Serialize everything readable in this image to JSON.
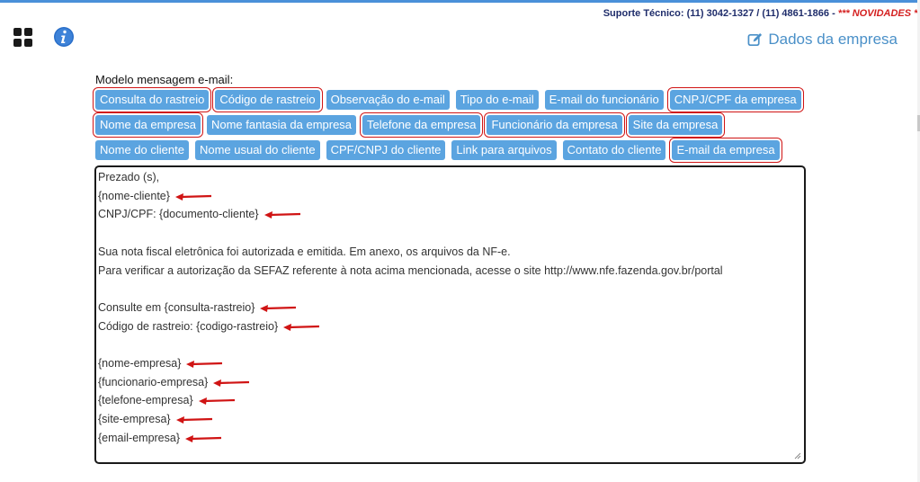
{
  "header": {
    "support_text": "Suporte Técnico: (11) 3042-1327 / (11) 4861-1866 - ",
    "novidades": "*** NOVIDADES ***"
  },
  "section": {
    "title": "Dados da empresa"
  },
  "editor": {
    "label": "Modelo mensagem e-mail:",
    "rows": [
      [
        {
          "label": "Consulta do rastreio",
          "highlight": true
        },
        {
          "label": "Código de rastreio",
          "highlight": true
        },
        {
          "label": "Observação do e-mail",
          "highlight": false
        },
        {
          "label": "Tipo do e-mail",
          "highlight": false
        },
        {
          "label": "E-mail do funcionário",
          "highlight": false
        },
        {
          "label": "CNPJ/CPF da empresa",
          "highlight": true
        }
      ],
      [
        {
          "label": "Nome da empresa",
          "highlight": true
        },
        {
          "label": "Nome fantasia da empresa",
          "highlight": false
        },
        {
          "label": "Telefone da empresa",
          "highlight": true
        },
        {
          "label": "Funcionário da empresa",
          "highlight": true
        },
        {
          "label": "Site da empresa",
          "highlight": true
        }
      ],
      [
        {
          "label": "Nome do cliente",
          "highlight": false
        },
        {
          "label": "Nome usual do cliente",
          "highlight": false
        },
        {
          "label": "CPF/CNPJ do cliente",
          "highlight": false
        },
        {
          "label": "Link para arquivos",
          "highlight": false
        },
        {
          "label": "Contato do cliente",
          "highlight": false
        },
        {
          "label": "E-mail da empresa",
          "highlight": true
        }
      ]
    ],
    "lines": [
      "Prezado (s),",
      "{nome-cliente}",
      "CNPJ/CPF: {documento-cliente}",
      "",
      "Sua nota fiscal eletrônica foi autorizada e emitida. Em anexo, os arquivos da NF-e.",
      "Para verificar a autorização da SEFAZ referente à nota acima mencionada, acesse o site http://www.nfe.fazenda.gov.br/portal",
      "",
      "Consulte em {consulta-rastreio}",
      "Código de rastreio: {codigo-rastreio}",
      "",
      "{nome-empresa}",
      "{funcionario-empresa}",
      "{telefone-empresa}",
      "{site-empresa}",
      "{email-empresa}"
    ],
    "arrow_lines": [
      1,
      2,
      7,
      8,
      10,
      11,
      12,
      13,
      14
    ],
    "arrow_color": "#d01414"
  }
}
